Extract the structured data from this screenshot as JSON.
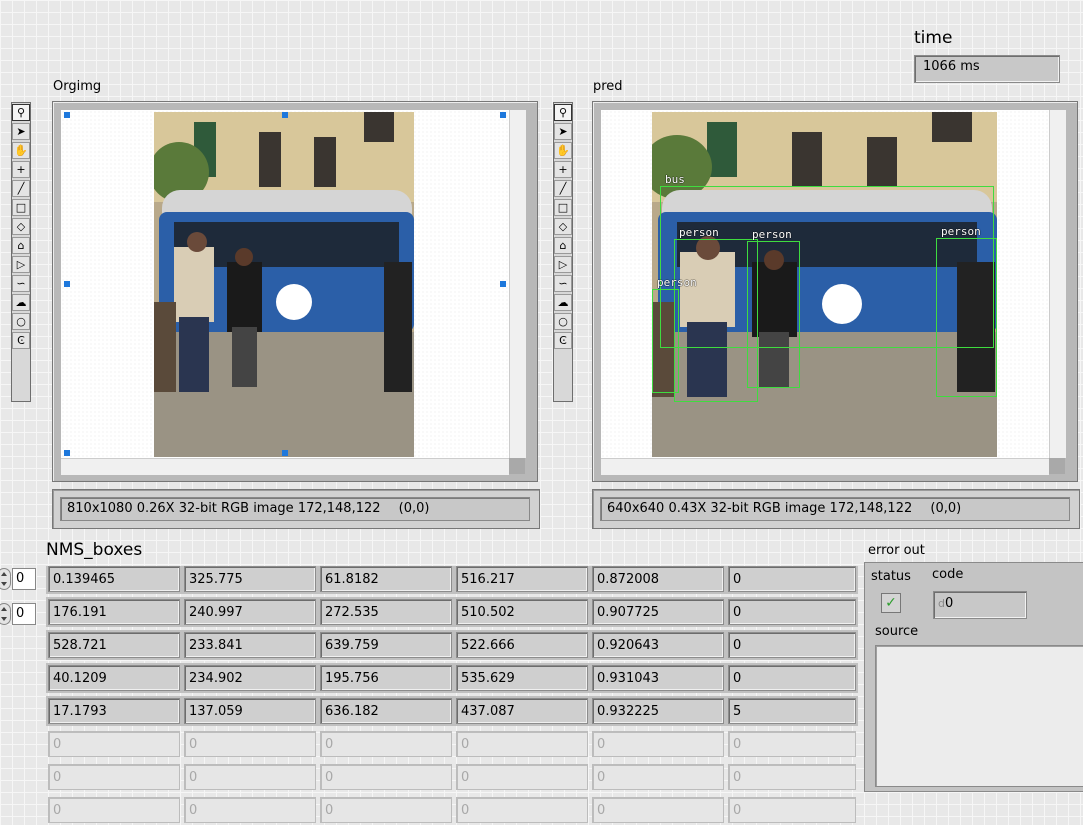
{
  "time": {
    "label": "time",
    "value": "1066 ms"
  },
  "orig_display": {
    "label": "Orgimg",
    "status": "810x1080 0.26X 32-bit RGB image 172,148,122",
    "coord": "(0,0)"
  },
  "pred_display": {
    "label": "pred",
    "status": "640x640 0.43X 32-bit RGB image 172,148,122",
    "coord": "(0,0)",
    "detections": [
      "bus",
      "person",
      "person",
      "person",
      "person"
    ]
  },
  "palette_tools": [
    {
      "name": "zoom-icon",
      "glyph": "⚲"
    },
    {
      "name": "arrow-pointer-icon",
      "glyph": "➤"
    },
    {
      "name": "pan-hand-icon",
      "glyph": "✋"
    },
    {
      "name": "crosshair-icon",
      "glyph": "+"
    },
    {
      "name": "line-icon",
      "glyph": "╱"
    },
    {
      "name": "rectangle-icon",
      "glyph": "□"
    },
    {
      "name": "rotated-rect-icon",
      "glyph": "◇"
    },
    {
      "name": "annulus-icon",
      "glyph": "⌂"
    },
    {
      "name": "polygon-icon",
      "glyph": "▷"
    },
    {
      "name": "freehand-icon",
      "glyph": "∽"
    },
    {
      "name": "freehand-region-icon",
      "glyph": "☁"
    },
    {
      "name": "oval-icon",
      "glyph": "○"
    },
    {
      "name": "annulus-arc-icon",
      "glyph": "Ͼ"
    }
  ],
  "nms": {
    "label": "NMS_boxes",
    "row_index": "0",
    "col_index": "0",
    "rows": [
      [
        "0.139465",
        "325.775",
        "61.8182",
        "516.217",
        "0.872008",
        "0"
      ],
      [
        "176.191",
        "240.997",
        "272.535",
        "510.502",
        "0.907725",
        "0"
      ],
      [
        "528.721",
        "233.841",
        "639.759",
        "522.666",
        "0.920643",
        "0"
      ],
      [
        "40.1209",
        "234.902",
        "195.756",
        "535.629",
        "0.931043",
        "0"
      ],
      [
        "17.1793",
        "137.059",
        "636.182",
        "437.087",
        "0.932225",
        "5"
      ],
      [
        "0",
        "0",
        "0",
        "0",
        "0",
        "0"
      ],
      [
        "0",
        "0",
        "0",
        "0",
        "0",
        "0"
      ],
      [
        "0",
        "0",
        "0",
        "0",
        "0",
        "0"
      ]
    ]
  },
  "error_out": {
    "label": "error out",
    "status_label": "status",
    "code_label": "code",
    "code_value": "0",
    "code_prefix": "d",
    "source_label": "source",
    "check": "✓"
  },
  "colors": {
    "bbox": "#3fdc3f",
    "status_ok": "#2e9e2e",
    "handle": "#1e78dc"
  }
}
